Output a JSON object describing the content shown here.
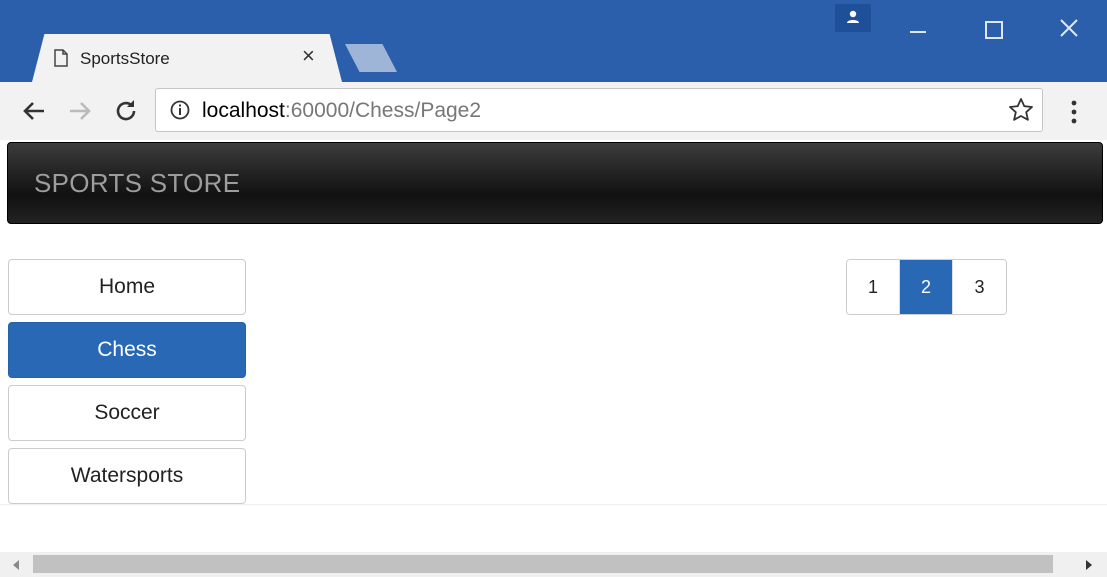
{
  "browser": {
    "tab_title": "SportsStore",
    "tab_close": "×",
    "url_host": "localhost",
    "url_rest": ":60000/Chess/Page2",
    "icons": [
      "page-icon",
      "profile-icon",
      "back-icon",
      "forward-icon",
      "reload-icon",
      "info-icon",
      "star-icon",
      "menu-icon"
    ]
  },
  "page": {
    "brand": "SPORTS STORE",
    "categories": [
      {
        "label": "Home",
        "active": false
      },
      {
        "label": "Chess",
        "active": true
      },
      {
        "label": "Soccer",
        "active": false
      },
      {
        "label": "Watersports",
        "active": false
      }
    ],
    "pagination": [
      {
        "label": "1",
        "active": false
      },
      {
        "label": "2",
        "active": true
      },
      {
        "label": "3",
        "active": false
      }
    ]
  },
  "colors": {
    "titlebar": "#2b5fac",
    "active": "#2868b5"
  }
}
